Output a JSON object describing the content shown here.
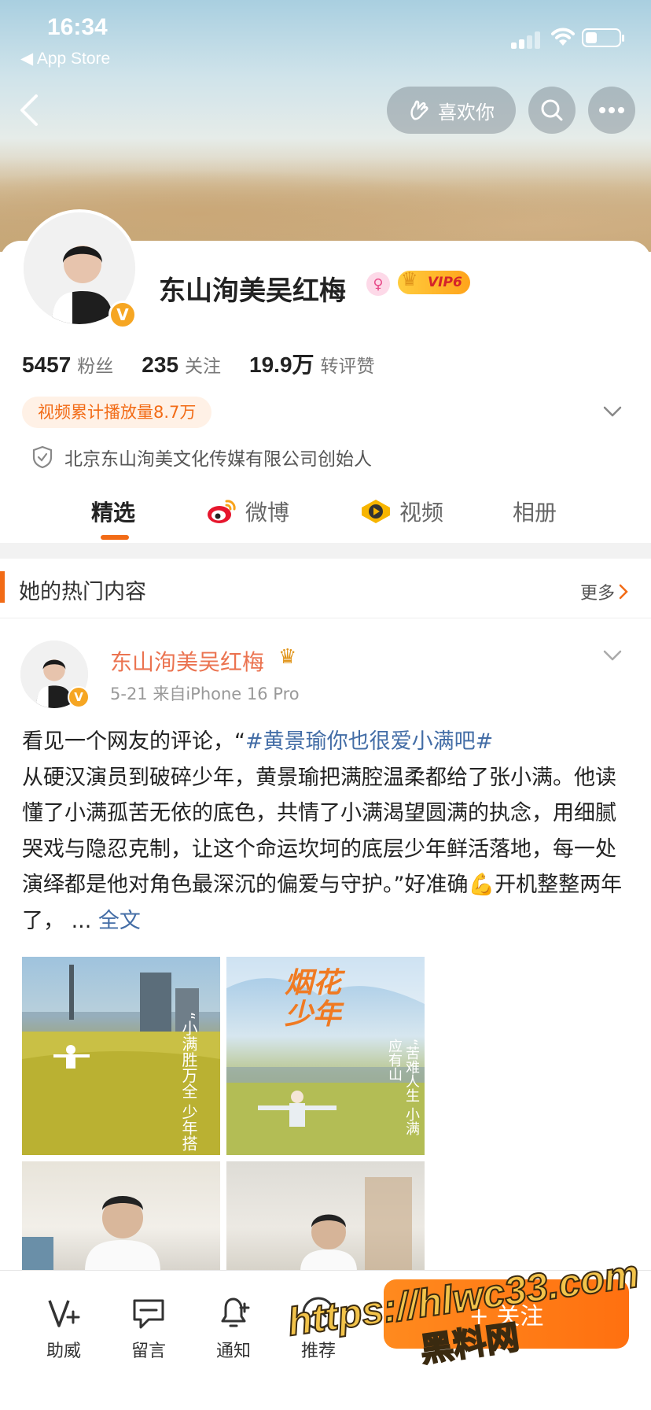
{
  "status_bar": {
    "time": "16:34",
    "back_app": "◀ App Store"
  },
  "header": {
    "like_label": "喜欢你"
  },
  "profile": {
    "name": "东山洵美吴红梅",
    "gender_symbol": "♀",
    "vip_label": "VIP6",
    "verified_mark": "V",
    "stats": [
      {
        "num": "5457",
        "label": "粉丝"
      },
      {
        "num": "235",
        "label": "关注"
      },
      {
        "num": "19.9万",
        "label": "转评赞"
      }
    ],
    "video_tag": "视频累计播放量8.7万",
    "company": "北京东山洵美文化传媒有限公司创始人"
  },
  "tabs": [
    {
      "label": "精选"
    },
    {
      "label": "微博"
    },
    {
      "label": "视频"
    },
    {
      "label": "相册"
    }
  ],
  "hot": {
    "title": "她的热门内容",
    "more": "更多"
  },
  "post": {
    "author": "东山洵美吴红梅",
    "meta": "5-21  来自iPhone 16 Pro",
    "text_intro": "看见一个网友的评论，“",
    "topic": "#黄景瑜你也很爱小满吧#",
    "text_body": "从硬汉演员到破碎少年，黄景瑜把满腔温柔都给了张小满。他读懂了小满孤苦无依的底色，共情了小满渴望圆满的执念，用细腻哭戏与隐忍克制，让这个命运坎坷的底层少年鲜活落地，每一处演绎都是他对角色最深沉的偏爱与守护。”好准确",
    "emoji": "💪",
    "text_tail": "开机整整两年了，  ... ",
    "full_label": "全文",
    "image1_text": "“小满胜万全 少年搭",
    "image2_title": "烟花少年",
    "image2_text": "“苦难人生 小满 应有山"
  },
  "bottom": {
    "items": [
      {
        "label": "助威"
      },
      {
        "label": "留言"
      },
      {
        "label": "通知"
      },
      {
        "label": "推荐"
      }
    ],
    "follow_label": "+ 关注"
  },
  "watermark": {
    "url": "https://hlwc33.com",
    "cn": "黑料网"
  }
}
